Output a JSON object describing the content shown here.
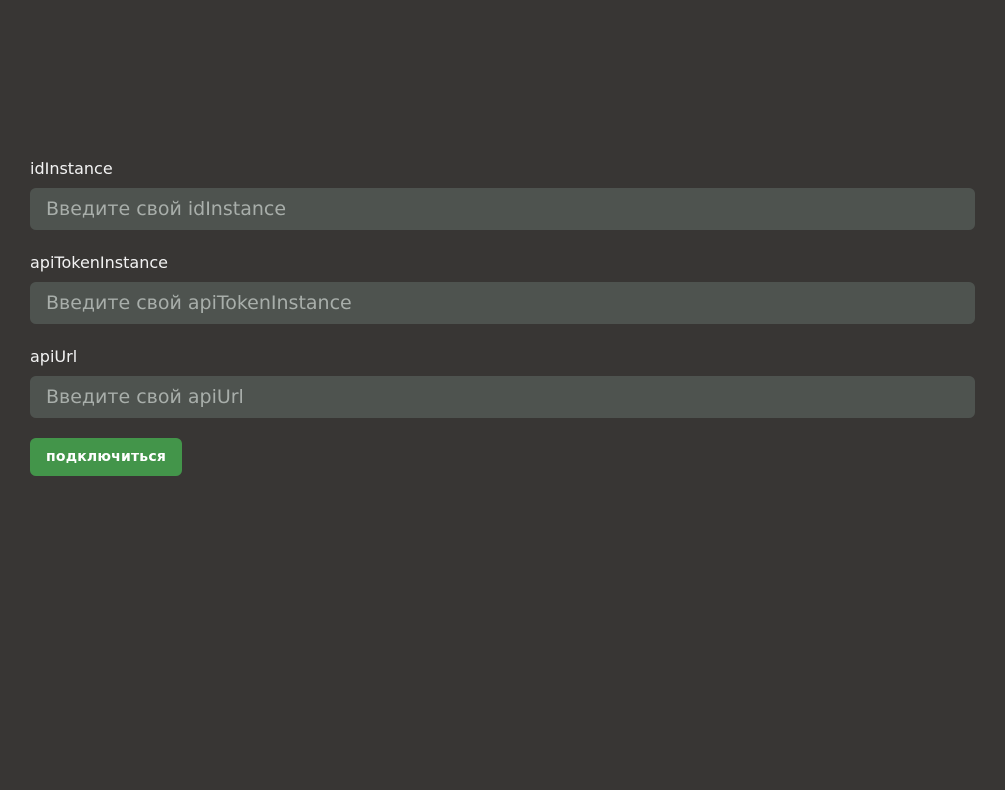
{
  "form": {
    "id_instance": {
      "label": "idInstance",
      "value": "",
      "placeholder": "Введите свой idInstance"
    },
    "api_token_instance": {
      "label": "apiTokenInstance",
      "value": "",
      "placeholder": "Введите свой apiTokenInstance"
    },
    "api_url": {
      "label": "apiUrl",
      "value": "",
      "placeholder": "Введите свой apiUrl"
    },
    "connect_label": "подключиться"
  },
  "colors": {
    "background": "#383634",
    "input_background": "#4e534f",
    "button_background": "#43954a",
    "text": "#f2f2f2"
  }
}
